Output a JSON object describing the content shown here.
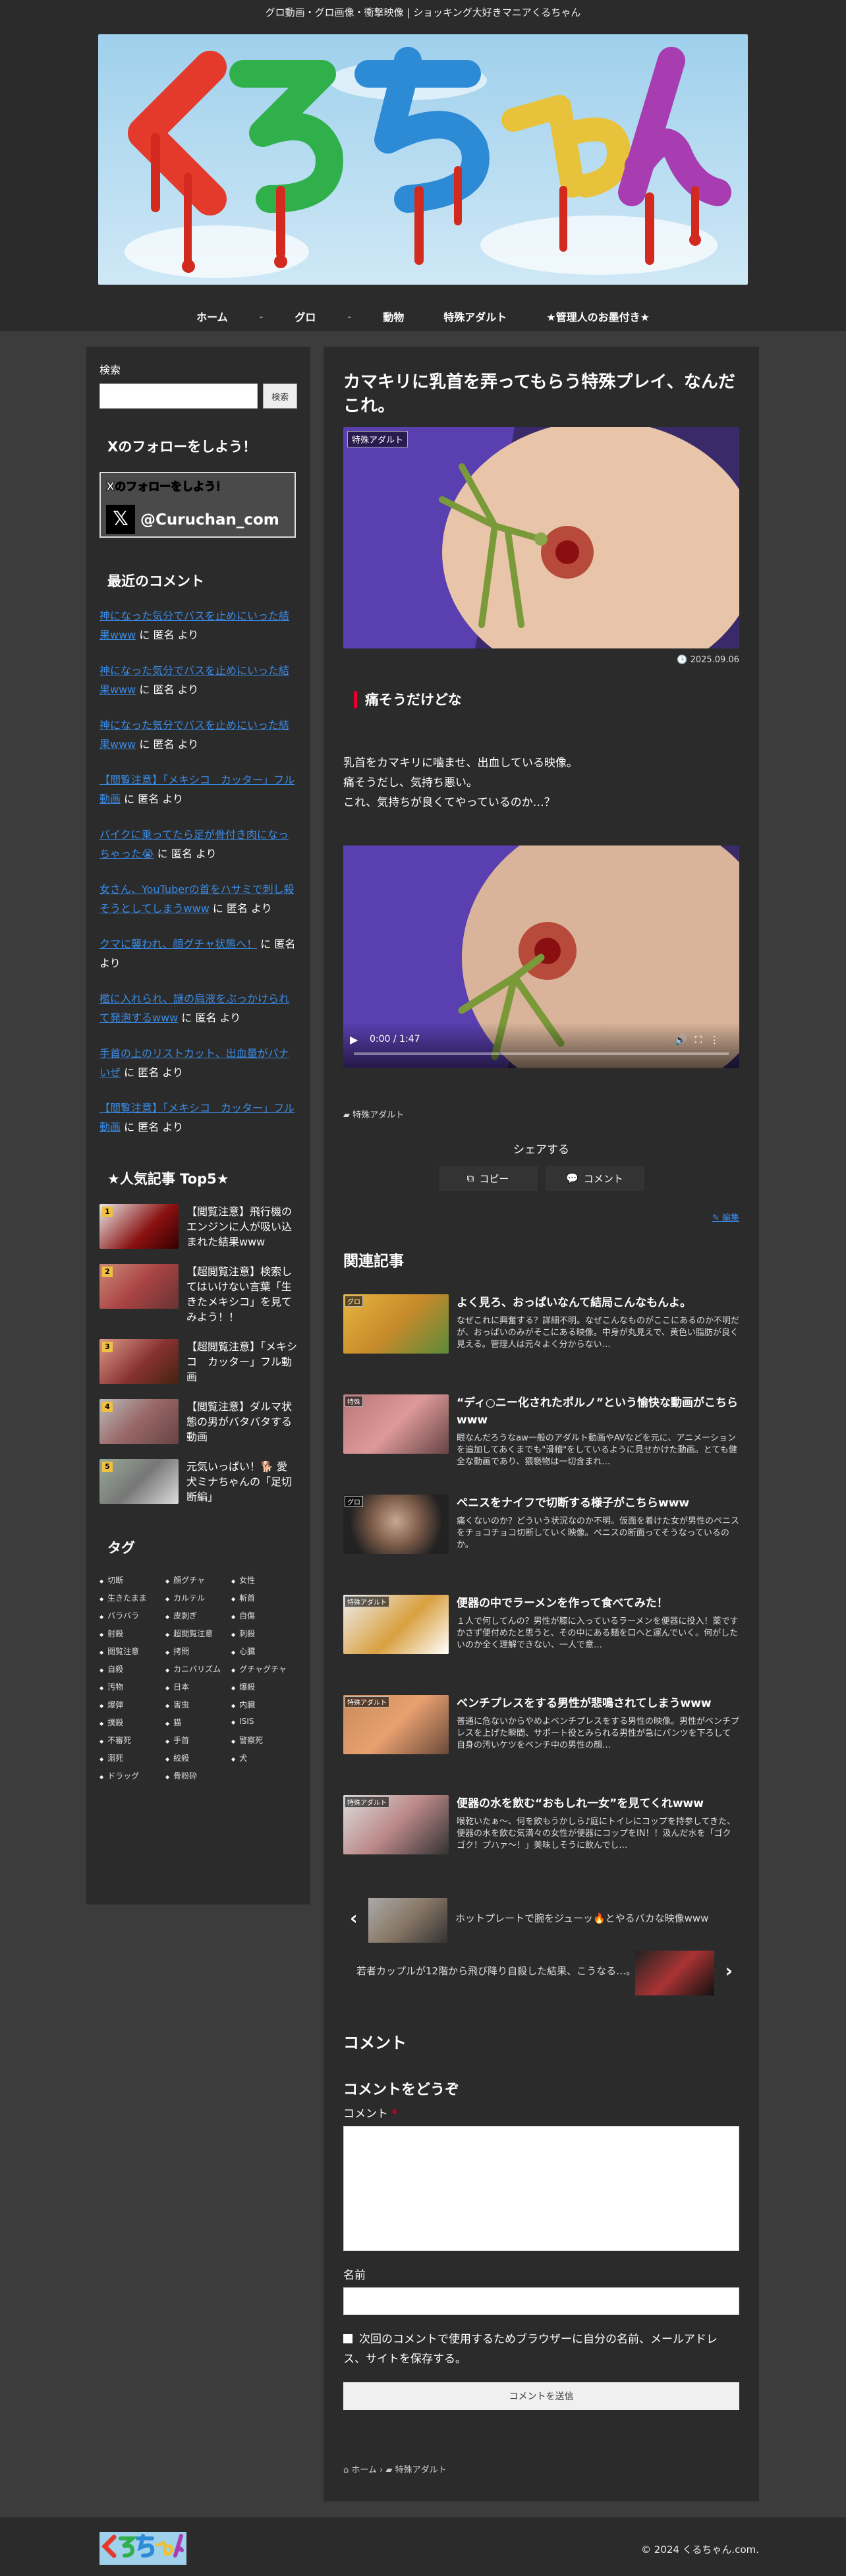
{
  "topbar": {
    "tagline": "グロ動画・グロ画像・衝撃映像 | ショッキング大好きマニアくるちゃん"
  },
  "site": {
    "logo_text": "くるちゃん"
  },
  "nav": {
    "items": [
      "ホーム",
      "グロ",
      "動物",
      "特殊アダルト",
      "★管理人のお墨付き★"
    ],
    "separators": [
      "-",
      "-"
    ]
  },
  "sidebar": {
    "search_label": "検索",
    "search_button": "検索",
    "follow_heading": "Xのフォローをしよう！",
    "follow_banner": {
      "line1": "Xのフォローをしよう！",
      "handle": "@Curuchan_com"
    },
    "comments_heading": "最近のコメント",
    "comments": [
      {
        "link": "神になった気分でバスを止めにいった結果www",
        "by": "に 匿名 より"
      },
      {
        "link": "神になった気分でバスを止めにいった結果www",
        "by": "に 匿名 より"
      },
      {
        "link": "神になった気分でバスを止めにいった結果www",
        "by": "に 匿名 より"
      },
      {
        "link": "【閲覧注意】「メキシコ　カッター」フル動画",
        "by": "に 匿名 より"
      },
      {
        "link": "バイクに乗ってたら足が骨付き肉になっちゃった😭",
        "by": "に 匿名 より"
      },
      {
        "link": "女さん、YouTuberの首をハサミで刺し殺そうとしてしまうwww",
        "by": "に 匿名 より"
      },
      {
        "link": "クマに襲われ、顔グチャ状態へ！",
        "by": "に 匿名 より"
      },
      {
        "link": "檻に入れられ、謎の肩液をぶっかけられて発泡するwww",
        "by": "に 匿名 より"
      },
      {
        "link": "手首の上のリストカット、出血量がパナいぜ",
        "by": "に 匿名 より"
      },
      {
        "link": "【閲覧注意】「メキシコ　カッター」フル動画",
        "by": "に 匿名 より"
      }
    ],
    "popular_heading": "★人気記事 Top5★",
    "popular": [
      {
        "rank": "1",
        "title": "【閲覧注意】飛行機のエンジンに人が吸い込まれた結果www"
      },
      {
        "rank": "2",
        "title": "【超閲覧注意】検索してはいけない言葉「生きたメキシコ」を見てみよう！！"
      },
      {
        "rank": "3",
        "title": "【超閲覧注意】「メキシコ　カッター」フル動画"
      },
      {
        "rank": "4",
        "title": "【閲覧注意】ダルマ状態の男がバタバタする動画"
      },
      {
        "rank": "5",
        "title": "元気いっぱい！🐕 愛犬ミナちゃんの「足切断編」"
      }
    ],
    "tags_heading": "タグ",
    "tags": [
      "切断",
      "顔グチャ",
      "女性",
      "生きたまま",
      "カルテル",
      "斬首",
      "バラバラ",
      "皮剥ぎ",
      "自傷",
      "射殺",
      "超閲覧注意",
      "刺殺",
      "閲覧注意",
      "拷問",
      "心臓",
      "自殺",
      "カニバリズム",
      "グチャグチャ",
      "汚物",
      "日本",
      "爆殺",
      "爆弾",
      "害虫",
      "内臓",
      "撲殺",
      "猫",
      "ISIS",
      "不審死",
      "手首",
      "警察死",
      "溺死",
      "絞殺",
      "犬",
      "ドラッグ",
      "骨粉砕"
    ]
  },
  "article": {
    "title": "カマキリに乳首を弄ってもらう特殊プレイ、なんだこれ。",
    "category_badge": "特殊アダルト",
    "date": "2025.09.06",
    "h2": "痛そうだけどな",
    "body": [
      "乳首をカマキリに噛ませ、出血している映像。",
      "痛そうだし、気持ち悪い。",
      "これ、気持ちが良くてやっているのか…？"
    ],
    "video": {
      "time": "0:00 / 1:47"
    },
    "post_category": "特殊アダルト",
    "share_label": "シェアする",
    "copy_button": "コピー",
    "comment_button": "コメント",
    "edit_link": "編集"
  },
  "related": {
    "heading": "関連記事",
    "items": [
      {
        "cat": "グロ",
        "title": "よく見ろ、おっぱいなんて結局こんなもんよ。",
        "excerpt": "なぜこれに興奮する？詳細不明。なぜこんなものがここにあるのか不明だが、おっぱいのみがそこにある映像。中身が丸見えで、黄色い脂肪が良く見える。管理人は元々よく分からない…"
      },
      {
        "cat": "特殊",
        "title": "“ディ○ニー化されたポルノ”という愉快な動画がこちらwww",
        "excerpt": "眼なんだろうなaw一般のアダルト動画やAVなどを元に、アニメーションを追加してあくまでも\"滑稽\"をしているように見せかけた動画。とても健全な動画であり、猥褻物は一切含まれ…"
      },
      {
        "cat": "グロ",
        "title": "ペニスをナイフで切断する様子がこちらwww",
        "excerpt": "痛くないのか？どういう状況なのか不明。仮面を着けた女が男性のペニスをチョコチョコ切断していく映像。ペニスの断面ってそうなっているのか。"
      },
      {
        "cat": "特殊アダルト",
        "title": "便器の中でラーメンを作って食べてみた！",
        "excerpt": "１人で何してんの？男性が膝に入っているラーメンを便器に投入！薬ですかさず便付めたと思うと、その中にある麺を口へと運んでいく。何がしたいのか全く理解できない、一人で意…"
      },
      {
        "cat": "特殊アダルト",
        "title": "ベンチプレスをする男性が悲鳴されてしまうwww",
        "excerpt": "普通に危ないからやめよベンチプレスをする男性の映像。男性がベンチプレスを上げた瞬間、サポート役とみられる男性が急にパンツを下ろして自身の汚いケツをベンチ中の男性の顔…"
      },
      {
        "cat": "特殊アダルト",
        "title": "便器の水を飲む“おもしれ一女”を見てくれwww",
        "excerpt": "喉乾いたぁ〜、何を飲もうかしら♪庭にトイレにコップを持参してきた、便器の水を飲む気満々の女性が便器にコップをIN！！汲んだ水を「ゴクゴク！プハァ〜！」美味しそうに飲んでし…"
      }
    ]
  },
  "prevnext": {
    "prev": "ホットプレートで腕をジューッ🔥とやるバカな映像www",
    "next": "若者カップルが12階から飛び降り自殺した結果、こうなる…。"
  },
  "comment_form": {
    "heading": "コメント",
    "form_heading": "コメントをどうぞ",
    "comment_label": "コメント",
    "required_mark": "*",
    "name_label": "名前",
    "save_label": "次回のコメントで使用するためブラウザーに自分の名前、メールアドレス、サイトを保存する。",
    "submit": "コメントを送信"
  },
  "breadcrumb": [
    "ホーム",
    "特殊アダルト"
  ],
  "footer": {
    "copyright": "© 2024 くるちゃん.com."
  },
  "colors": {
    "bg": "#3c3c3c",
    "panel": "#2b2b2b",
    "link": "#3a8be6",
    "accent": "#e5002b"
  }
}
